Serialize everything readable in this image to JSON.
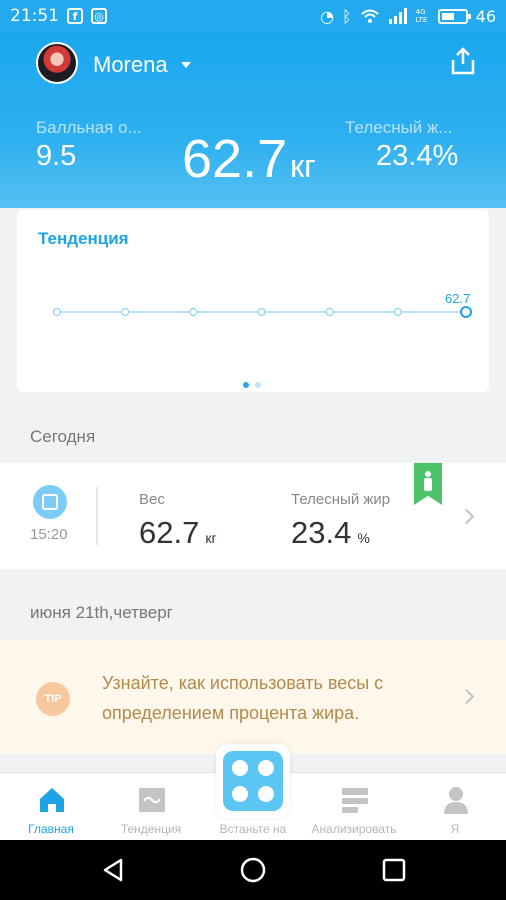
{
  "status_bar": {
    "time": "21:51",
    "left_icons": [
      "facebook-icon",
      "instagram-icon"
    ],
    "right_icons": [
      "data-saver-icon",
      "bluetooth-icon",
      "wifi-icon",
      "signal-icon",
      "lte-icon"
    ],
    "network": "4G LTE",
    "battery": "46",
    "battery_level": 0.46
  },
  "header": {
    "user_name": "Morena",
    "share_icon": "share-icon",
    "score_label": "Балльная о...",
    "score_value": "9.5",
    "weight_value": "62.7",
    "weight_unit": "кг",
    "fat_label": "Телесный ж...",
    "fat_value": "23.4%"
  },
  "trend_card": {
    "title": "Тенденция",
    "last_value_label": "62.7",
    "page_count": 2,
    "active_page": 0
  },
  "chart_data": {
    "type": "line",
    "title": "Тенденция",
    "points": 7,
    "values": [
      null,
      null,
      null,
      null,
      null,
      null,
      62.7
    ],
    "data_labels": [
      "62.7"
    ]
  },
  "today": {
    "section_title": "Сегодня",
    "time": "15:20",
    "weight_label": "Вес",
    "weight_value": "62.7",
    "weight_unit": "кг",
    "fat_label": "Телесный жир",
    "fat_value": "23.4",
    "fat_unit": "%"
  },
  "date_section": {
    "title": "июня 21th,четверг"
  },
  "tip": {
    "badge": "TIP",
    "text": "Узнайте, как использовать весы с определением процента жира."
  },
  "bottom_nav": {
    "items": [
      {
        "label": "Главная",
        "icon": "home-icon",
        "active": true
      },
      {
        "label": "Тенденция",
        "icon": "trend-icon",
        "active": false
      },
      {
        "label": "Встаньте на",
        "icon": "scale-icon",
        "active": false
      },
      {
        "label": "Анализировать",
        "icon": "analyze-icon",
        "active": false
      },
      {
        "label": "Я",
        "icon": "profile-icon",
        "active": false
      }
    ]
  },
  "colors": {
    "accent": "#1da3e6",
    "header_top": "#1aa7ee",
    "tip_text": "#b38a4c",
    "bookmark_green": "#4cc36a"
  }
}
